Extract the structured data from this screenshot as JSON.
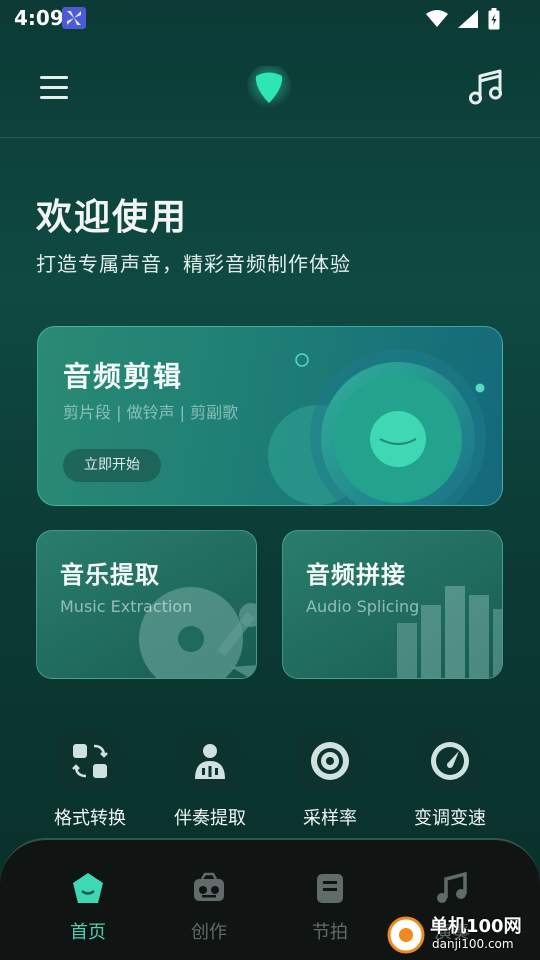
{
  "status_bar": {
    "time": "4:09",
    "icons": [
      "app-notification-icon",
      "wifi-icon",
      "signal-icon",
      "battery-icon"
    ]
  },
  "header": {
    "menu_icon": "hamburger-menu-icon",
    "logo_icon": "guitar-pick-logo-icon",
    "music_icon": "music-note-icon"
  },
  "welcome": {
    "title": "欢迎使用",
    "subtitle": "打造专属声音，精彩音频制作体验"
  },
  "main_card": {
    "title": "音频剪辑",
    "tags": "剪片段 | 做铃声 | 剪副歌",
    "button_label": "立即开始"
  },
  "feature_cards": [
    {
      "title": "音乐提取",
      "subtitle": "Music Extraction"
    },
    {
      "title": "音频拼接",
      "subtitle": "Audio Splicing"
    }
  ],
  "tools": [
    {
      "label": "格式转换",
      "icon": "format-convert-icon"
    },
    {
      "label": "伴奏提取",
      "icon": "accompaniment-extract-icon"
    },
    {
      "label": "采样率",
      "icon": "sample-rate-icon"
    },
    {
      "label": "变调变速",
      "icon": "pitch-speed-icon"
    }
  ],
  "bottom_nav": [
    {
      "label": "首页",
      "icon": "home-icon",
      "active": true
    },
    {
      "label": "创作",
      "icon": "create-icon",
      "active": false
    },
    {
      "label": "节拍",
      "icon": "metronome-icon",
      "active": false
    },
    {
      "label": "演奏",
      "icon": "perform-icon",
      "active": false
    }
  ],
  "watermark": {
    "line1": "单机100网",
    "line2": "danji100.com"
  },
  "colors": {
    "accent": "#4fd0ae",
    "background": "#0e4a42",
    "nav_background": "#101413"
  }
}
